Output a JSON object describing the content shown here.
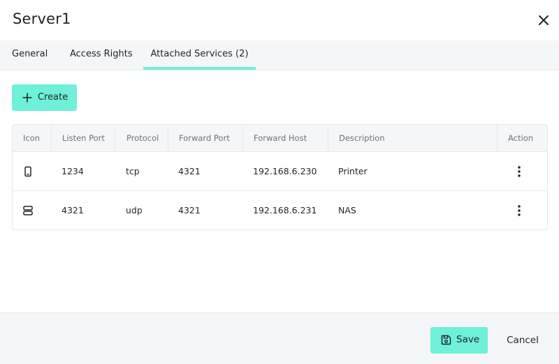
{
  "dialog": {
    "title": "Server1",
    "close_icon": "close-icon"
  },
  "tabs": [
    {
      "label": "General"
    },
    {
      "label": "Access Rights"
    },
    {
      "label": "Attached Services (2)",
      "active": true
    }
  ],
  "toolbar": {
    "create_label": "Create",
    "create_icon": "plus-icon"
  },
  "table": {
    "columns": [
      "Icon",
      "Listen Port",
      "Protocol",
      "Forward Port",
      "Forward Host",
      "Description",
      "Action"
    ],
    "rows": [
      {
        "icon": "mobile-device-icon",
        "listen_port": "1234",
        "protocol": "tcp",
        "forward_port": "4321",
        "forward_host": "192.168.6.230",
        "description": "Printer",
        "action_icon": "more-vertical-icon"
      },
      {
        "icon": "server-icon",
        "listen_port": "4321",
        "protocol": "udp",
        "forward_port": "4321",
        "forward_host": "192.168.6.231",
        "description": "NAS",
        "action_icon": "more-vertical-icon"
      }
    ]
  },
  "footer": {
    "save_label": "Save",
    "save_icon": "floppy-disk-icon",
    "cancel_label": "Cancel"
  },
  "colors": {
    "accent": "#6ff0d8",
    "surface": "#f5f6f7",
    "border": "#e4e7ea",
    "text": "#1f2329",
    "muted_text": "#6c737b"
  }
}
